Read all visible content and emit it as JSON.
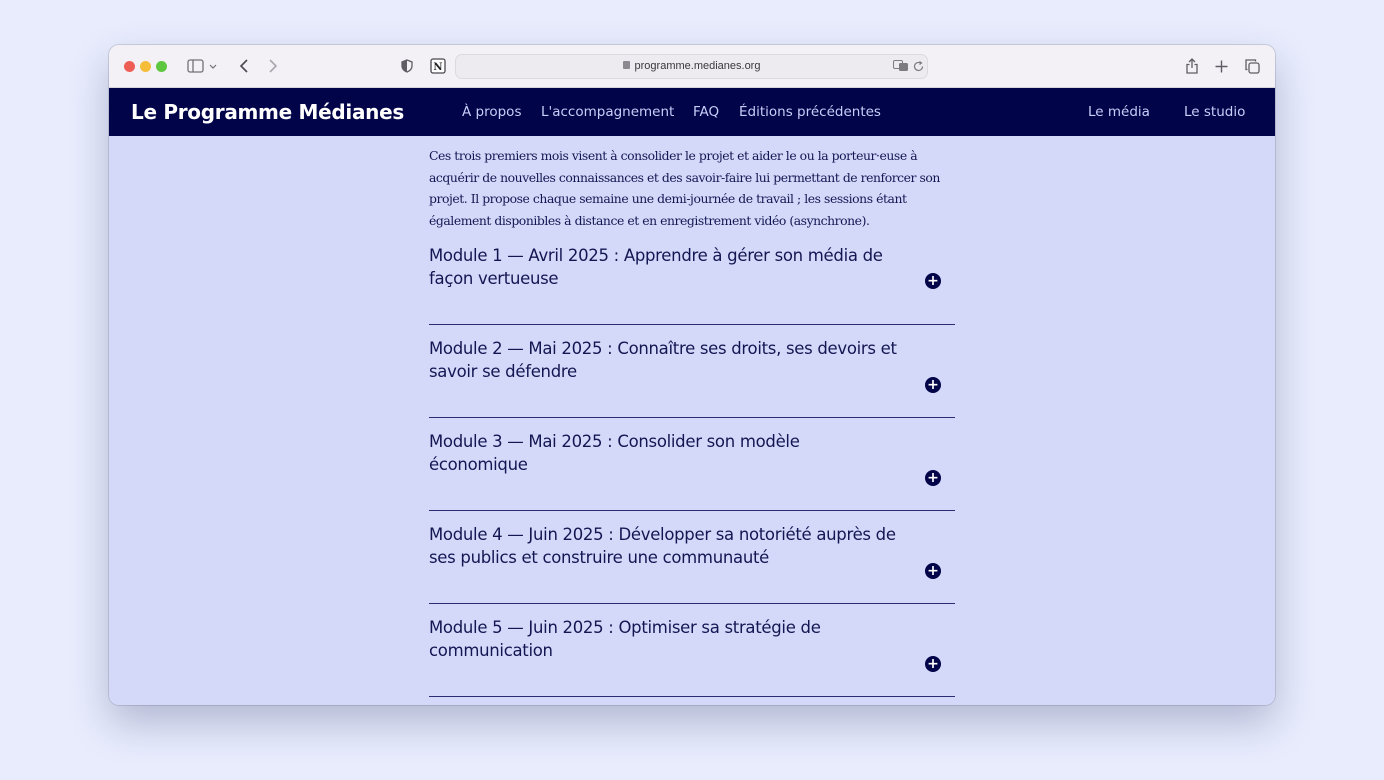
{
  "browser": {
    "url": "programme.medianes.org",
    "back_icon": "chevron-left-icon",
    "forward_icon": "chevron-right-icon"
  },
  "site": {
    "title": "Le Programme Médianes",
    "nav": [
      "À propos",
      "L'accompagnement",
      "FAQ",
      "Éditions précédentes"
    ],
    "nav_right": [
      "Le média",
      "Le studio"
    ]
  },
  "main": {
    "intro": "Ces trois premiers mois visent à consolider le projet et aider le ou la porteur·euse à acquérir de nouvelles connaissances et des savoir-faire lui permettant de renforcer son projet. Il propose chaque semaine une demi-journée de travail ; les sessions étant également disponibles à distance et en enregistrement vidéo (asynchrone).",
    "modules": [
      "Module 1 — Avril 2025 : Apprendre à gérer son média de façon vertueuse",
      "Module 2 — Mai 2025 : Connaître ses droits, ses devoirs et savoir se défendre",
      "Module 3 — Mai 2025 : Consolider son modèle économique",
      "Module 4 — Juin 2025 : Développer sa notoriété auprès de ses publics et construire une communauté",
      "Module 5 — Juin 2025 : Optimiser sa stratégie de communication"
    ]
  },
  "colors": {
    "page_bg": "#e8ecfd",
    "nav_bg": "#010448",
    "content_bg": "#d4d9fa",
    "text": "#141652"
  }
}
